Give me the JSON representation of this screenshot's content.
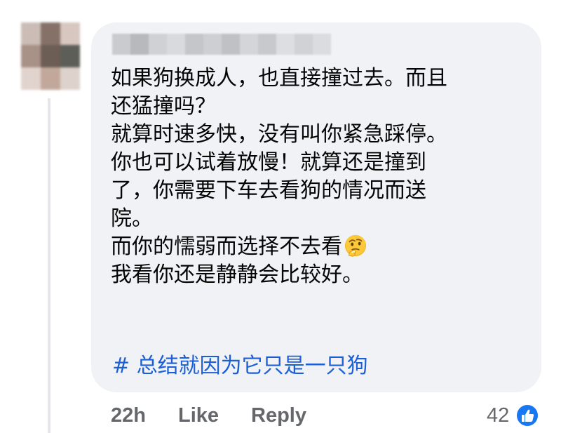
{
  "comment": {
    "author_name": "",
    "lines": [
      "如果狗换成人，也直接撞过去。而且",
      "还猛撞吗？",
      "就算时速多快，没有叫你紧急踩停。",
      "你也可以试着放慢！就算还是撞到",
      "了，你需要下车去看狗的情况而送",
      "院。",
      "而你的懦弱而选择不去看",
      "我看你还是静静会比较好。"
    ],
    "emoji_icon": "thinking-face-icon",
    "hashtag": "# 总结就因为它只是一只狗"
  },
  "actions": {
    "time": "22h",
    "like_label": "Like",
    "reply_label": "Reply"
  },
  "reactions": {
    "count": "42",
    "icon": "like-thumb-icon",
    "color": "#1877f2"
  },
  "colors": {
    "bubble": "#f0f2f5",
    "text": "#050505",
    "meta": "#65676b",
    "hashtag": "#1b5fd6"
  }
}
